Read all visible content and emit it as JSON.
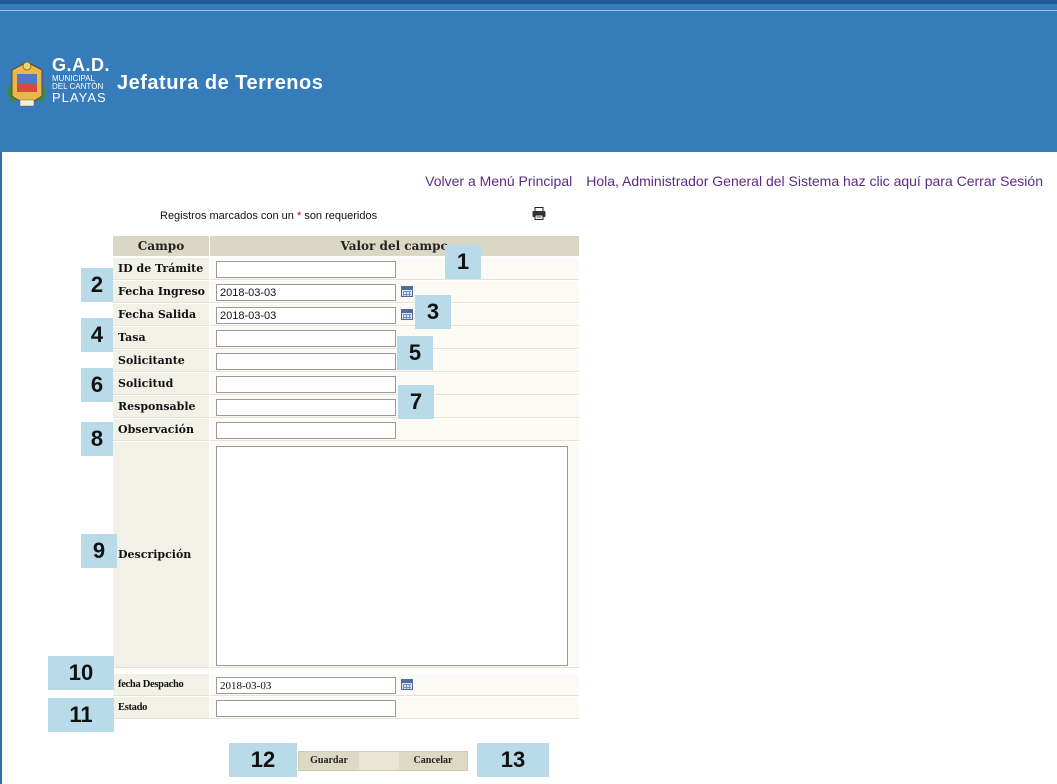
{
  "header": {
    "logo": {
      "line1": "G.A.D.",
      "line2": "MUNICIPAL",
      "line3": "DEL CANTÓN",
      "line4": "PLAYAS"
    },
    "title": "Jefatura de Terrenos",
    "colors": {
      "banner": "#367bba",
      "text": "#ffffff"
    }
  },
  "topnav": {
    "menu_link": "Volver a Menú Principal",
    "logout_link": "Hola, Administrador General del Sistema haz clic aquí para Cerrar Sesión"
  },
  "form": {
    "required_note_prefix": "Registros marcados con un",
    "required_star": "*",
    "required_note_suffix": "son requeridos",
    "print_icon": "printer-icon",
    "headers": {
      "field": "Campo",
      "value": "Valor del campo"
    },
    "fields": {
      "id_tramite": {
        "label": "ID de Trámite",
        "value": ""
      },
      "fecha_ingreso": {
        "label": "Fecha Ingreso",
        "value": "2018-03-03"
      },
      "fecha_salida": {
        "label": "Fecha Salida",
        "value": "2018-03-03"
      },
      "tasa": {
        "label": "Tasa",
        "value": ""
      },
      "solicitante": {
        "label": "Solicitante",
        "value": ""
      },
      "solicitud": {
        "label": "Solicitud",
        "value": ""
      },
      "responsable": {
        "label": "Responsable",
        "value": ""
      },
      "observacion": {
        "label": "Observación",
        "value": ""
      },
      "descripcion": {
        "label": "Descripción",
        "value": ""
      },
      "fecha_despacho": {
        "label": "fecha Despacho",
        "value": "2018-03-03"
      },
      "estado": {
        "label": "Estado",
        "value": ""
      }
    },
    "buttons": {
      "save": "Guardar",
      "cancel": "Cancelar"
    }
  },
  "annotations": {
    "n1": "1",
    "n2": "2",
    "n3": "3",
    "n4": "4",
    "n5": "5",
    "n6": "6",
    "n7": "7",
    "n8": "8",
    "n9": "9",
    "n10": "10",
    "n11": "11",
    "n12": "12",
    "n13": "13",
    "color": "#b9dbe9"
  }
}
